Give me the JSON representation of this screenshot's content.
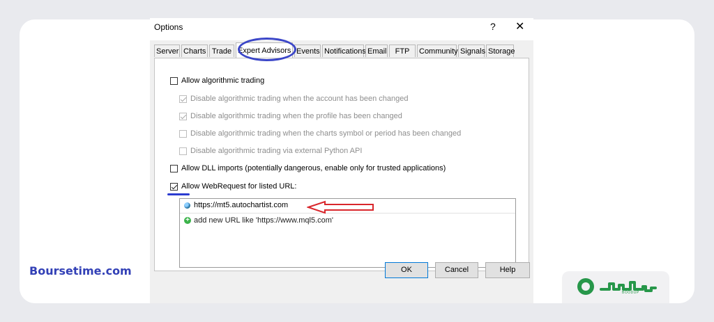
{
  "dialog": {
    "title": "Options",
    "help_glyph": "?",
    "close_glyph": "✕"
  },
  "tabs": [
    {
      "label": "Server"
    },
    {
      "label": "Charts"
    },
    {
      "label": "Trade"
    },
    {
      "label": "Expert Advisors",
      "active": true
    },
    {
      "label": "Events"
    },
    {
      "label": "Notifications"
    },
    {
      "label": "Email"
    },
    {
      "label": "FTP"
    },
    {
      "label": "Community"
    },
    {
      "label": "Signals"
    },
    {
      "label": "Storage"
    }
  ],
  "options": {
    "allow_algo": {
      "label": "Allow algorithmic trading",
      "checked": false
    },
    "disable_account": {
      "label": "Disable algorithmic trading when the account has been changed",
      "checked": true,
      "enabled": false
    },
    "disable_profile": {
      "label": "Disable algorithmic trading when the profile has been changed",
      "checked": true,
      "enabled": false
    },
    "disable_symbol": {
      "label": "Disable algorithmic trading when the charts symbol or period has been changed",
      "checked": false,
      "enabled": false
    },
    "disable_python": {
      "label": "Disable algorithmic trading via external Python API",
      "checked": false,
      "enabled": false
    },
    "allow_dll": {
      "label": "Allow DLL imports (potentially dangerous, enable only for trusted applications)",
      "checked": false
    },
    "allow_webrequest": {
      "label": "Allow WebRequest for listed URL:",
      "checked": true
    }
  },
  "url_list": {
    "entries": [
      "https://mt5.autochartist.com"
    ],
    "add_hint": "add new URL like 'https://www.mql5.com'"
  },
  "watermark": "Boursetime.com",
  "buttons": {
    "ok": "OK",
    "cancel": "Cancel",
    "help": "Help"
  },
  "icons": {
    "url_entry": "globe-icon",
    "add_url": "plus-circle-icon"
  },
  "colors": {
    "annotation_blue": "#3b46c8",
    "annotation_red": "#d9262b",
    "watermark": "#3240b6",
    "logo_green": "#27974a"
  },
  "logo": {
    "sub": "BOODUP"
  }
}
